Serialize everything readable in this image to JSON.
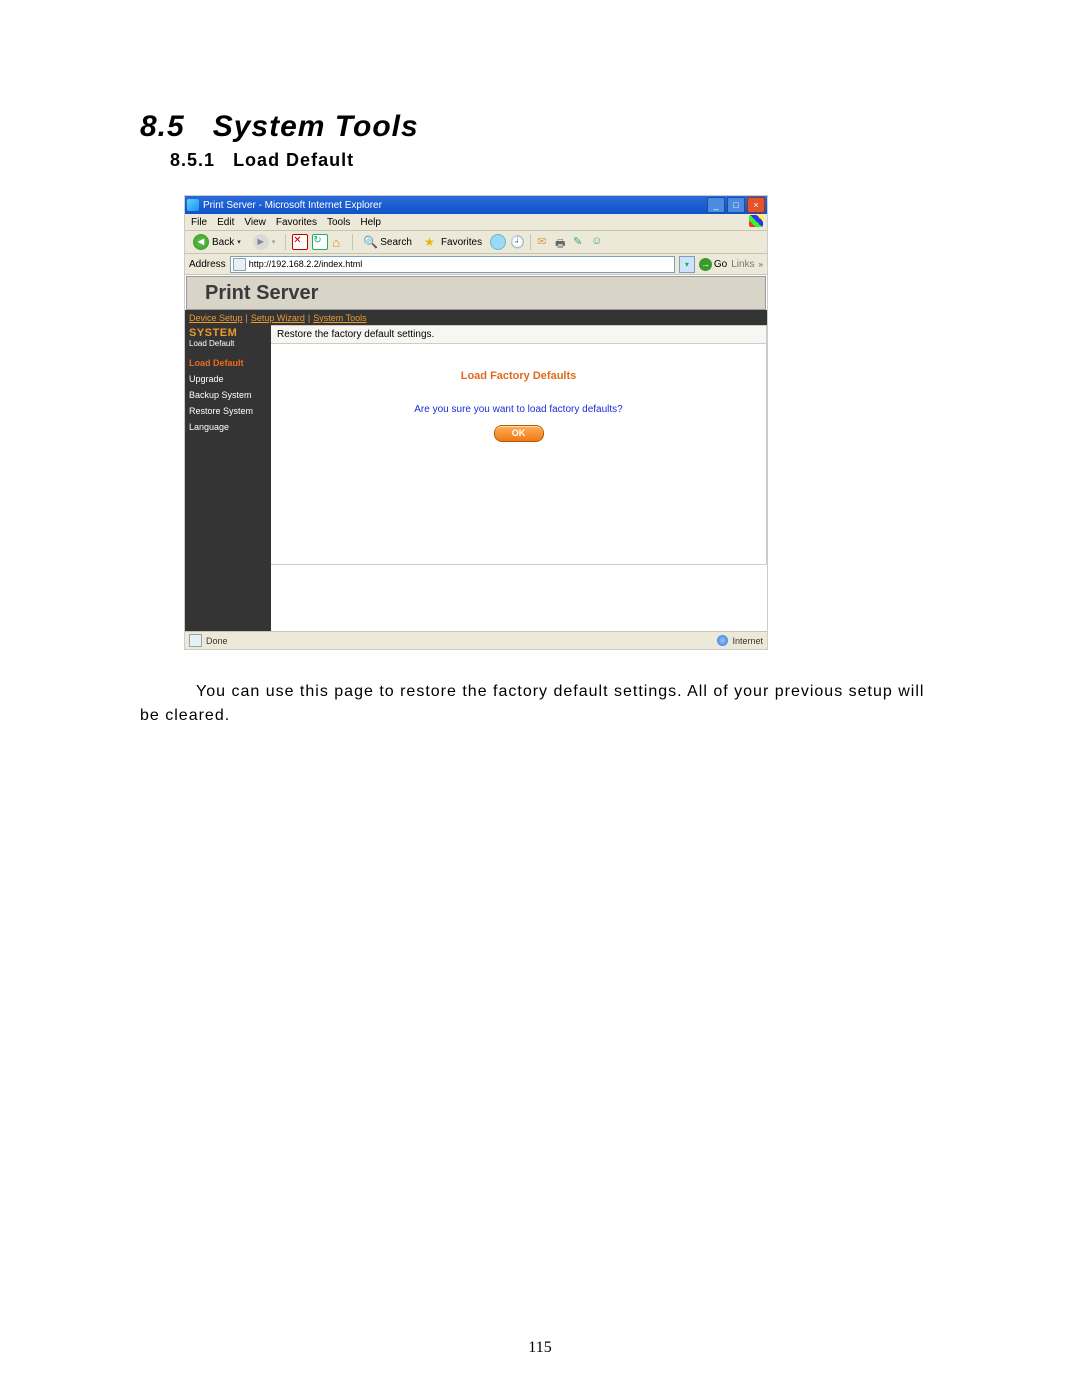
{
  "doc": {
    "section_number": "8.5",
    "section_title": "System Tools",
    "subsection_number": "8.5.1",
    "subsection_title": "Load Default",
    "body_text": "You can use this page to restore the factory default settings. All of your previous setup will be cleared.",
    "page_number": "115"
  },
  "browser": {
    "window_title": "Print Server - Microsoft Internet Explorer",
    "menus": {
      "file": "File",
      "edit": "Edit",
      "view": "View",
      "favorites": "Favorites",
      "tools": "Tools",
      "help": "Help"
    },
    "toolbar": {
      "back": "Back",
      "search": "Search",
      "favorites": "Favorites"
    },
    "address_label": "Address",
    "address_value": "http://192.168.2.2/index.html",
    "go_label": "Go",
    "links_label": "Links",
    "status_left": "Done",
    "status_zone": "Internet"
  },
  "app": {
    "header_title": "Print Server",
    "tabs": {
      "device_setup": "Device Setup",
      "setup_wizard": "Setup Wizard",
      "system_tools": "System Tools"
    },
    "sidebar": {
      "heading": "SYSTEM",
      "subheading": "Load Default",
      "items": {
        "load_default": "Load Default",
        "upgrade": "Upgrade",
        "backup_system": "Backup System",
        "restore_system": "Restore System",
        "language": "Language"
      }
    },
    "main": {
      "strip": "Restore the factory default settings.",
      "title": "Load Factory Defaults",
      "question": "Are you sure you want to load factory defaults?",
      "ok_label": "OK"
    }
  }
}
